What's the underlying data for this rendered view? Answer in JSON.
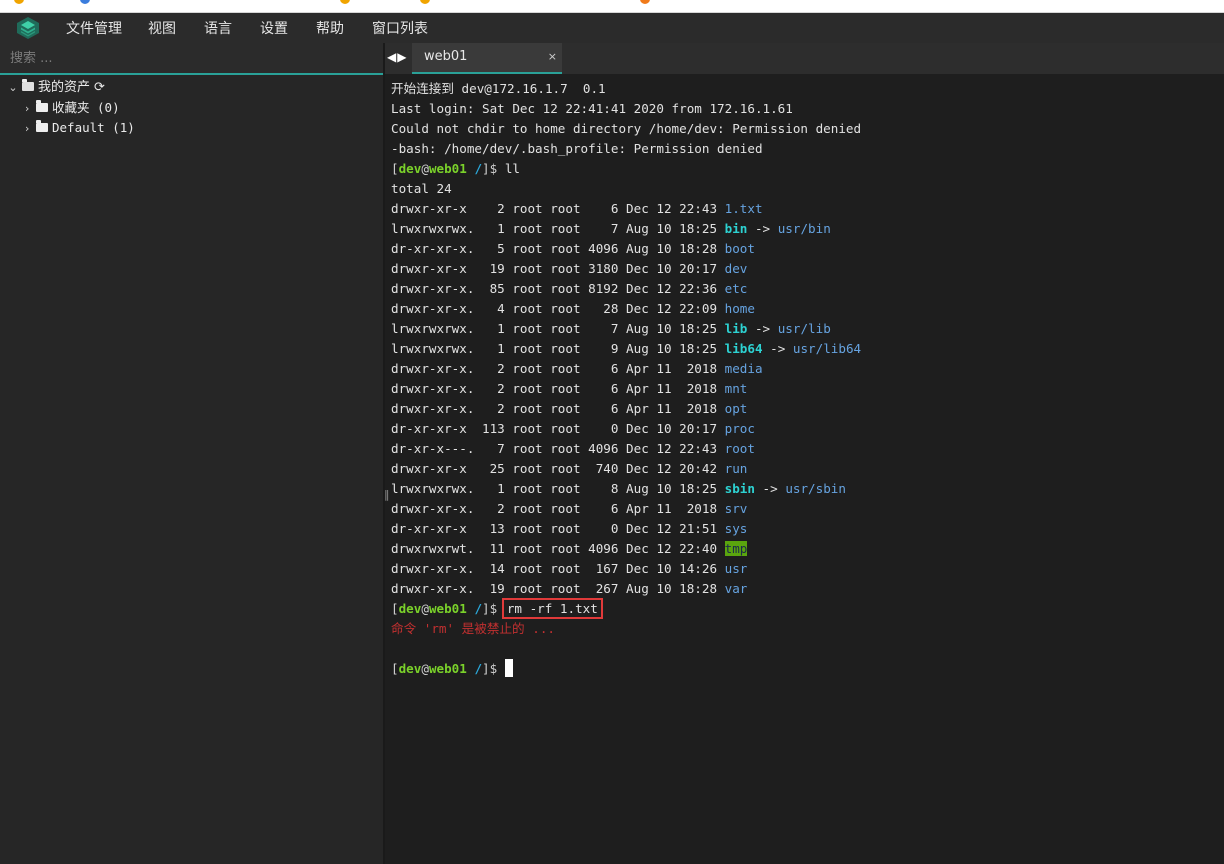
{
  "menu": {
    "items": [
      "文件管理",
      "视图",
      "语言",
      "设置",
      "帮助",
      "窗口列表"
    ]
  },
  "sidebar": {
    "search_placeholder": "搜索 ...",
    "root_label": "我的资产",
    "items": [
      {
        "label": "收藏夹 (0)"
      },
      {
        "label": "Default (1)"
      }
    ]
  },
  "tabs": [
    {
      "label": "web01",
      "close": "×"
    }
  ],
  "terminal": {
    "intro": [
      "开始连接到 dev@172.16.1.7  0.1",
      "Last login: Sat Dec 12 22:41:41 2020 from 172.16.1.61",
      "Could not chdir to home directory /home/dev: Permission denied",
      "-bash: /home/dev/.bash_profile: Permission denied"
    ],
    "prompt": {
      "open": "[",
      "user": "dev",
      "at": "@",
      "host": "web01",
      "path": "/",
      "close": "]",
      "dollar": "$"
    },
    "command1": "ll",
    "total": "total 24",
    "listing": [
      {
        "meta": "drwxr-xr-x    2 root root    6 Dec 12 22:43 ",
        "name": "1.txt",
        "kind": "dir"
      },
      {
        "meta": "lrwxrwxrwx.   1 root root    7 Aug 10 18:25 ",
        "name": "bin",
        "kind": "link",
        "target": "usr/bin"
      },
      {
        "meta": "dr-xr-xr-x.   5 root root 4096 Aug 10 18:28 ",
        "name": "boot",
        "kind": "dir"
      },
      {
        "meta": "drwxr-xr-x   19 root root 3180 Dec 10 20:17 ",
        "name": "dev",
        "kind": "dir"
      },
      {
        "meta": "drwxr-xr-x.  85 root root 8192 Dec 12 22:36 ",
        "name": "etc",
        "kind": "dir"
      },
      {
        "meta": "drwxr-xr-x.   4 root root   28 Dec 12 22:09 ",
        "name": "home",
        "kind": "dir"
      },
      {
        "meta": "lrwxrwxrwx.   1 root root    7 Aug 10 18:25 ",
        "name": "lib",
        "kind": "link",
        "target": "usr/lib"
      },
      {
        "meta": "lrwxrwxrwx.   1 root root    9 Aug 10 18:25 ",
        "name": "lib64",
        "kind": "link",
        "target": "usr/lib64"
      },
      {
        "meta": "drwxr-xr-x.   2 root root    6 Apr 11  2018 ",
        "name": "media",
        "kind": "dir"
      },
      {
        "meta": "drwxr-xr-x.   2 root root    6 Apr 11  2018 ",
        "name": "mnt",
        "kind": "dir"
      },
      {
        "meta": "drwxr-xr-x.   2 root root    6 Apr 11  2018 ",
        "name": "opt",
        "kind": "dir"
      },
      {
        "meta": "dr-xr-xr-x  113 root root    0 Dec 10 20:17 ",
        "name": "proc",
        "kind": "dir"
      },
      {
        "meta": "dr-xr-x---.   7 root root 4096 Dec 12 22:43 ",
        "name": "root",
        "kind": "dir"
      },
      {
        "meta": "drwxr-xr-x   25 root root  740 Dec 12 20:42 ",
        "name": "run",
        "kind": "dir"
      },
      {
        "meta": "lrwxrwxrwx.   1 root root    8 Aug 10 18:25 ",
        "name": "sbin",
        "kind": "link",
        "target": "usr/sbin"
      },
      {
        "meta": "drwxr-xr-x.   2 root root    6 Apr 11  2018 ",
        "name": "srv",
        "kind": "dir"
      },
      {
        "meta": "dr-xr-xr-x   13 root root    0 Dec 12 21:51 ",
        "name": "sys",
        "kind": "dir"
      },
      {
        "meta": "drwxrwxrwt.  11 root root 4096 Dec 12 22:40 ",
        "name": "tmp",
        "kind": "sticky"
      },
      {
        "meta": "drwxr-xr-x.  14 root root  167 Dec 10 14:26 ",
        "name": "usr",
        "kind": "dir"
      },
      {
        "meta": "drwxr-xr-x.  19 root root  267 Aug 10 18:28 ",
        "name": "var",
        "kind": "dir"
      }
    ],
    "arrow": " -> ",
    "command2": "rm -rf 1.txt",
    "error": "命令 'rm' 是被禁止的 ..."
  },
  "colors": {
    "accent": "#2aa198",
    "prompt_user": "#7bd22a",
    "prompt_path": "#2aa7d9",
    "directory": "#66a3e0",
    "symlink": "#2dd2d2",
    "error": "#c23030",
    "highlight_box": "#e03a3a"
  }
}
